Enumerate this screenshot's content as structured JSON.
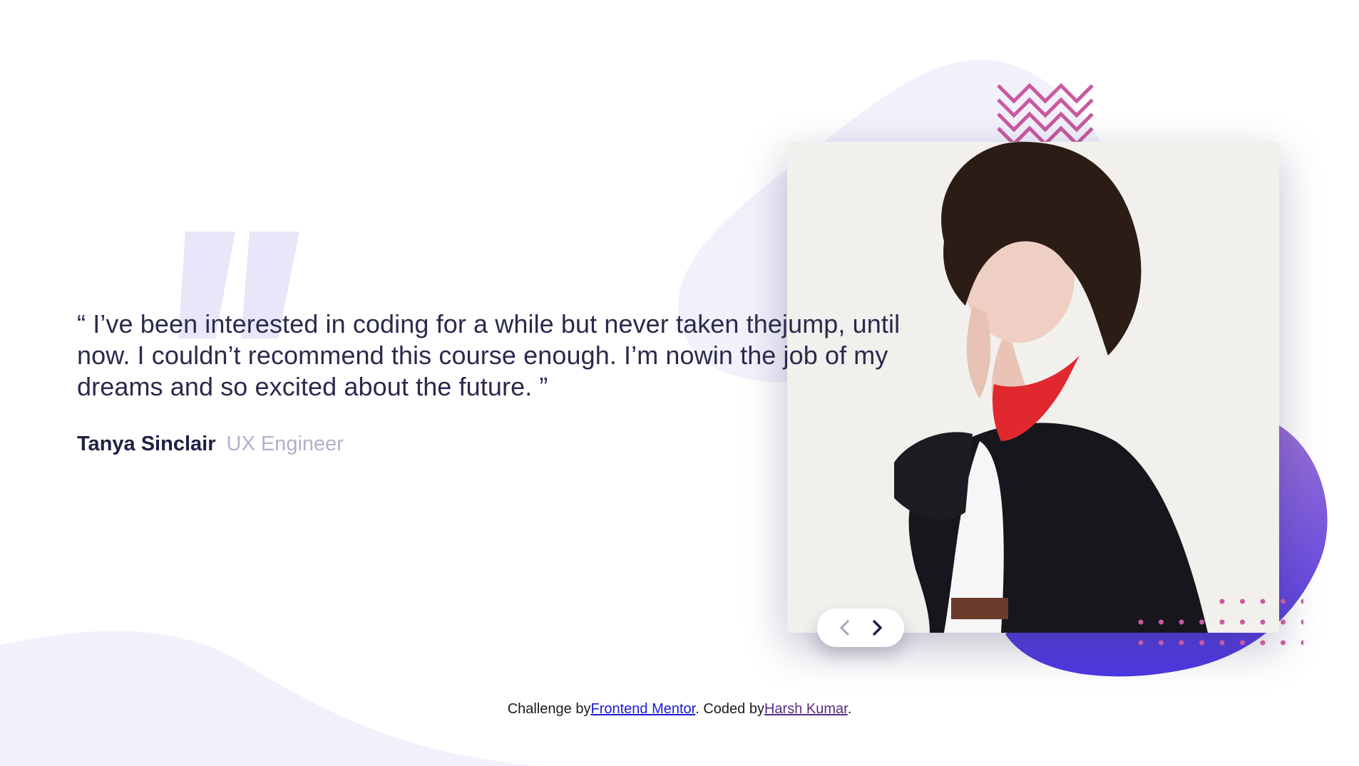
{
  "testimonial": {
    "quote": "“ I’ve been interested in coding for a while but never taken thejump, until now. I couldn’t recommend this course enough. I’m nowin the job of my dreams and so excited about the future. ”",
    "author_name": "Tanya Sinclair",
    "author_role": "UX Engineer"
  },
  "icons": {
    "quote_mark": "quote-icon",
    "prev": "chevron-left-icon",
    "next": "chevron-right-icon",
    "zigzag": "zigzag-pattern",
    "dots": "dot-grid-pattern"
  },
  "footer": {
    "prefix": "Challenge by",
    "link1": "Frontend Mentor",
    "middle": ". Coded by",
    "link2": "Harsh Kumar",
    "suffix": "."
  },
  "colors": {
    "text_dark": "#202046",
    "text_muted": "#b1b1cd",
    "blob_light": "#f2f1fb",
    "gradient_start": "#8a6ad6",
    "gradient_end": "#4d38e3",
    "accent_pink": "#c85aa0"
  }
}
